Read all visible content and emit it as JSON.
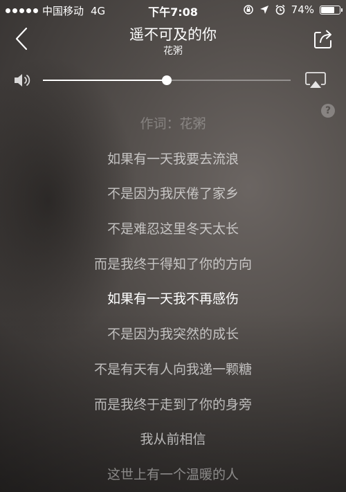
{
  "status_bar": {
    "carrier": "中国移动",
    "network": "4G",
    "time": "下午7:08",
    "battery_percent_text": "74%",
    "battery_level": 0.74,
    "signal_dots": 5
  },
  "header": {
    "song_title": "遥不可及的你",
    "artist": "花粥",
    "back_icon": "chevron-left-icon",
    "share_icon": "share-icon"
  },
  "volume": {
    "level": 0.5,
    "speaker_icon": "speaker-icon",
    "airplay_icon": "airplay-icon"
  },
  "help": {
    "label": "?"
  },
  "lyrics": {
    "active_index": 5,
    "lines": [
      {
        "text": "作词：花粥",
        "state": "faint"
      },
      {
        "text": "如果有一天我要去流浪",
        "state": "normal"
      },
      {
        "text": "不是因为我厌倦了家乡",
        "state": "normal"
      },
      {
        "text": "不是难忍这里冬天太长",
        "state": "normal"
      },
      {
        "text": "而是我终于得知了你的方向",
        "state": "normal"
      },
      {
        "text": "如果有一天我不再感伤",
        "state": "active"
      },
      {
        "text": "不是因为我突然的成长",
        "state": "normal"
      },
      {
        "text": "不是有天有人向我递一颗糖",
        "state": "normal"
      },
      {
        "text": "而是我终于走到了你的身旁",
        "state": "normal"
      },
      {
        "text": "我从前相信",
        "state": "normal"
      },
      {
        "text": "这世上有一个温暖的人",
        "state": "dim"
      }
    ]
  },
  "colors": {
    "text_primary": "#ffffff",
    "background": "#4f4a47"
  }
}
